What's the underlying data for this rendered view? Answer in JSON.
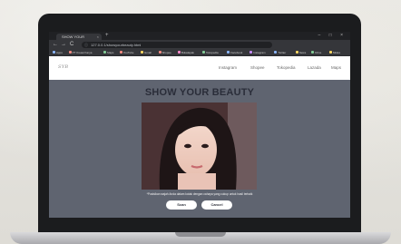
{
  "browser": {
    "tab_title": "SHOW YOUR",
    "tab_close": "×",
    "new_tab": "+",
    "window_controls": "– □ ×",
    "back": "←",
    "forward": "→",
    "reload": "C",
    "lock": "ⓘ",
    "address": "127.0.0.1/showyourbeauty.html",
    "bookmarks": [
      {
        "label": "Apps",
        "color": "#8ab4f8"
      },
      {
        "label": "PT Kreasi Karya",
        "color": "#f28b82"
      },
      {
        "label": "Maps",
        "color": "#81c995"
      },
      {
        "label": "YouTube",
        "color": "#f28b82"
      },
      {
        "label": "Gmail",
        "color": "#fdd663"
      },
      {
        "label": "Shopee",
        "color": "#f28b82"
      },
      {
        "label": "Bukalapak",
        "color": "#ff8bcb"
      },
      {
        "label": "Tokopedia",
        "color": "#81c995"
      },
      {
        "label": "Facebook",
        "color": "#8ab4f8"
      },
      {
        "label": "Instagram",
        "color": "#c58af9"
      },
      {
        "label": "Twitter",
        "color": "#8ab4f8"
      },
      {
        "label": "News",
        "color": "#fdd663"
      },
      {
        "label": "Drive",
        "color": "#81c995"
      },
      {
        "label": "Slides",
        "color": "#fdd663"
      }
    ]
  },
  "site": {
    "logo": "SYB",
    "nav": [
      "Instagram",
      "Shopee",
      "Tokopedia",
      "Lazada",
      "Maps"
    ],
    "headline": "SHOW YOUR BEAUTY",
    "caption": "*Posisikan wajah Anda dalam kotak dengan cahaya yang cukup untuk hasil terbaik",
    "buttons": {
      "scan": "Scan",
      "cancel": "Cancel"
    }
  },
  "colors": {
    "page_bg": "#5f6470",
    "headline": "#2a2d39"
  }
}
